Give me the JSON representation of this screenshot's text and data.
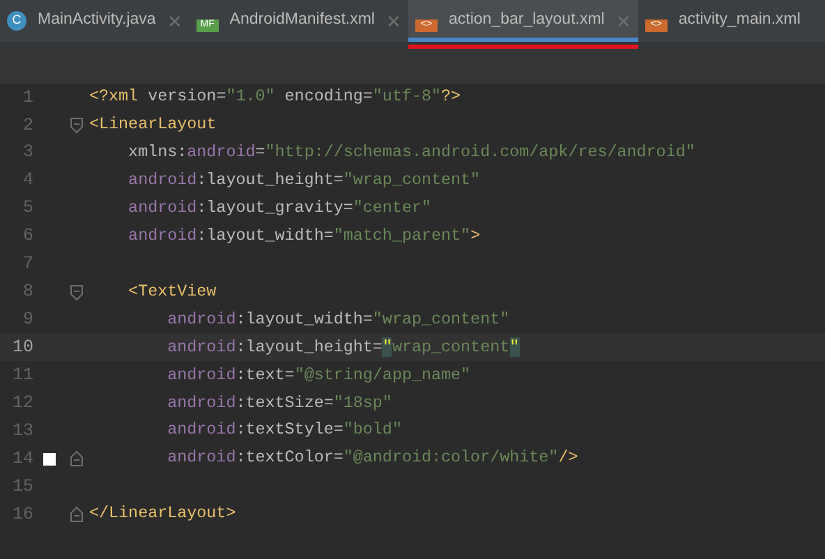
{
  "tabs": [
    {
      "label": "MainActivity.java",
      "kind": "java",
      "icon_text": "C",
      "selected": false,
      "close": "✕",
      "annotated": false
    },
    {
      "label": "AndroidManifest.xml",
      "kind": "manifest",
      "icon_text": "MF",
      "selected": false,
      "close": "✕",
      "annotated": false
    },
    {
      "label": "action_bar_layout.xml",
      "kind": "xml",
      "icon_text": "<>",
      "selected": true,
      "close": "✕",
      "annotated": true
    },
    {
      "label": "activity_main.xml",
      "kind": "xml",
      "icon_text": "<>",
      "selected": false,
      "annotated": false
    }
  ],
  "editor": {
    "lines": [
      {
        "number": "1",
        "current": false,
        "fold_open": false,
        "fold_close": false,
        "segments": [
          {
            "kind": "tag",
            "text": "<?xml "
          },
          {
            "kind": "attr",
            "text": "version="
          },
          {
            "kind": "value",
            "text": "\"1.0\" "
          },
          {
            "kind": "attr",
            "text": "encoding="
          },
          {
            "kind": "value",
            "text": "\"utf-8\""
          },
          {
            "kind": "tag",
            "text": "?>"
          }
        ]
      },
      {
        "number": "2",
        "current": false,
        "fold_open": true,
        "fold_close": false,
        "segments": [
          {
            "kind": "tag",
            "text": "<LinearLayout"
          }
        ]
      },
      {
        "number": "3",
        "current": false,
        "fold_open": false,
        "fold_close": false,
        "segments": [
          {
            "kind": "attr",
            "text": "    xmlns:"
          },
          {
            "kind": "ns",
            "text": "android"
          },
          {
            "kind": "attr",
            "text": "="
          },
          {
            "kind": "value",
            "text": "\"http://schemas.android.com/apk/res/android\""
          }
        ]
      },
      {
        "number": "4",
        "current": false,
        "fold_open": false,
        "fold_close": false,
        "segments": [
          {
            "kind": "ns",
            "text": "    android"
          },
          {
            "kind": "attr",
            "text": ":layout_height="
          },
          {
            "kind": "value",
            "text": "\"wrap_content\""
          }
        ]
      },
      {
        "number": "5",
        "current": false,
        "fold_open": false,
        "fold_close": false,
        "segments": [
          {
            "kind": "ns",
            "text": "    android"
          },
          {
            "kind": "attr",
            "text": ":layout_gravity="
          },
          {
            "kind": "value",
            "text": "\"center\""
          }
        ]
      },
      {
        "number": "6",
        "current": false,
        "fold_open": false,
        "fold_close": false,
        "segments": [
          {
            "kind": "ns",
            "text": "    android"
          },
          {
            "kind": "attr",
            "text": ":layout_width="
          },
          {
            "kind": "value",
            "text": "\"match_parent\""
          },
          {
            "kind": "tag",
            "text": ">"
          }
        ]
      },
      {
        "number": "7",
        "current": false,
        "fold_open": false,
        "fold_close": false
      },
      {
        "number": "8",
        "current": false,
        "fold_open": true,
        "fold_close": false,
        "segments": [
          {
            "kind": "tag",
            "text": "    <TextView"
          }
        ]
      },
      {
        "number": "9",
        "current": false,
        "fold_open": false,
        "fold_close": false,
        "segments": [
          {
            "kind": "ns",
            "text": "        android"
          },
          {
            "kind": "attr",
            "text": ":layout_width="
          },
          {
            "kind": "value",
            "text": "\"wrap_content\""
          }
        ]
      },
      {
        "number": "10",
        "current": true,
        "fold_open": false,
        "fold_close": false,
        "segments": [
          {
            "kind": "ns",
            "text": "        android"
          },
          {
            "kind": "attr",
            "text": ":layout_height="
          },
          {
            "kind": "match",
            "text": "\""
          },
          {
            "kind": "value",
            "text": "wrap_content"
          },
          {
            "kind": "match",
            "text": "\""
          }
        ]
      },
      {
        "number": "11",
        "current": false,
        "fold_open": false,
        "fold_close": false,
        "segments": [
          {
            "kind": "ns",
            "text": "        android"
          },
          {
            "kind": "attr",
            "text": ":text="
          },
          {
            "kind": "value",
            "text": "\"@string/app_name\""
          }
        ]
      },
      {
        "number": "12",
        "current": false,
        "fold_open": false,
        "fold_close": false,
        "segments": [
          {
            "kind": "ns",
            "text": "        android"
          },
          {
            "kind": "attr",
            "text": ":textSize="
          },
          {
            "kind": "value",
            "text": "\"18sp\""
          }
        ]
      },
      {
        "number": "13",
        "current": false,
        "fold_open": false,
        "fold_close": false,
        "segments": [
          {
            "kind": "ns",
            "text": "        android"
          },
          {
            "kind": "attr",
            "text": ":textStyle="
          },
          {
            "kind": "value",
            "text": "\"bold\""
          }
        ]
      },
      {
        "number": "14",
        "current": false,
        "fold_open": false,
        "fold_close": true,
        "color": "#ffffff",
        "segments": [
          {
            "kind": "ns",
            "text": "        android"
          },
          {
            "kind": "attr",
            "text": ":textColor="
          },
          {
            "kind": "value",
            "text": "\"@android:color/white\""
          },
          {
            "kind": "tag",
            "text": "/>"
          }
        ]
      },
      {
        "number": "15",
        "current": false,
        "fold_open": false,
        "fold_close": false
      },
      {
        "number": "16",
        "current": false,
        "fold_open": false,
        "fold_close": true,
        "segments": [
          {
            "kind": "tag",
            "text": "</LinearLayout>"
          }
        ]
      }
    ]
  }
}
